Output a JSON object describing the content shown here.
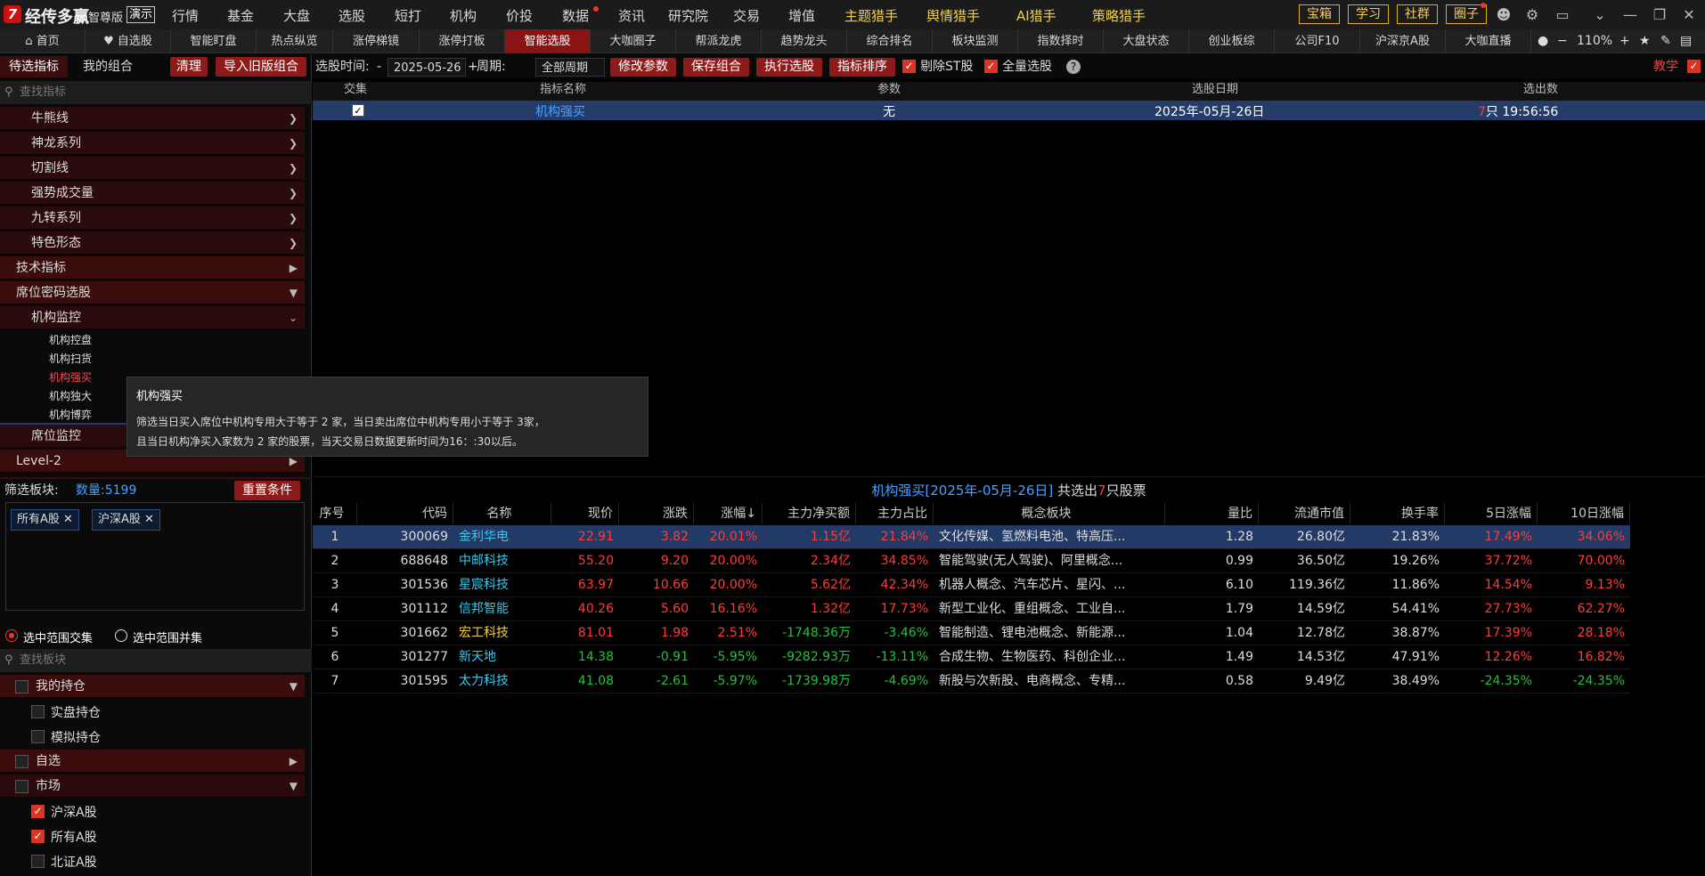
{
  "app": {
    "name": "经传多赢",
    "edition": "智尊版",
    "demo": "演示"
  },
  "top_nav": [
    "行情",
    "基金",
    "大盘",
    "选股",
    "短打",
    "机构",
    "价投",
    "数据",
    "资讯",
    "研究院",
    "交易",
    "增值"
  ],
  "top_nav_special": [
    "主题猎手",
    "舆情猎手",
    "AI猎手",
    "策略猎手"
  ],
  "top_right": [
    "宝箱",
    "学习",
    "社群",
    "圈子"
  ],
  "tabs": [
    "首页",
    "自选股",
    "智能盯盘",
    "热点纵览",
    "涨停梯镜",
    "涨停打板",
    "智能选股",
    "大咖圈子",
    "帮派龙虎",
    "趋势龙头",
    "综合排名",
    "板块监测",
    "指数择时",
    "大盘状态",
    "创业板综",
    "公司F10",
    "沪深京A股",
    "大咖直播"
  ],
  "zoom": "110%",
  "left": {
    "tab1": "待选指标",
    "tab2": "我的组合",
    "clear": "清理",
    "import": "导入旧版组合",
    "search_placeholder": "查找指标",
    "tree": [
      "牛熊线",
      "神龙系列",
      "切割线",
      "强势成交量",
      "九转系列",
      "特色形态",
      "技术指标",
      "席位密码选股",
      "机构监控"
    ],
    "leaves": [
      "机构控盘",
      "机构扫货",
      "机构强买",
      "机构独大",
      "机构博弈"
    ],
    "tree2": [
      "席位监控",
      "Level-2"
    ],
    "filter_label": "筛选板块:",
    "count": "数量:5199",
    "reset": "重置条件",
    "chips": [
      "所有A股",
      "沪深A股"
    ],
    "radio1": "选中范围交集",
    "radio2": "选中范围并集",
    "search2_placeholder": "查找板块",
    "groups": [
      "我的持仓",
      "实盘持仓",
      "模拟持仓",
      "自选",
      "市场",
      "沪深A股",
      "所有A股",
      "北证A股"
    ]
  },
  "filter": {
    "time_label": "选股时间:",
    "date": "2025-05-26",
    "period_label": "周期:",
    "period": "全部周期",
    "btn_modify": "修改参数",
    "btn_save": "保存组合",
    "btn_exec": "执行选股",
    "btn_sort": "指标排序",
    "exclude_st": "剔除ST股",
    "all_select": "全量选股",
    "teach": "教学"
  },
  "cond_table": {
    "headers": [
      "交集",
      "指标名称",
      "参数",
      "选股日期",
      "选出数"
    ],
    "row": {
      "name": "机构强买",
      "param": "无",
      "date": "2025年-05月-26日",
      "count": "7",
      "count_unit": "只",
      "time": "19:56:56"
    }
  },
  "tooltip": {
    "title": "机构强买",
    "line1": "筛选当日买入席位中机构专用大于等于 2 家，当日卖出席位中机构专用小于等于 3家，",
    "line2": "且当日机构净买入家数为 2 家的股票，当天交易日数据更新时间为16：:30以后。"
  },
  "result": {
    "title_pre": "机构强买[2025年-05月-26日]",
    "title_mid": " 共选出",
    "count": "7",
    "title_post": "只股票",
    "headers": [
      "序号",
      "代码",
      "名称",
      "现价",
      "涨跌",
      "涨幅↓",
      "主力净买额",
      "主力占比",
      "概念板块",
      "量比",
      "流通市值",
      "换手率",
      "5日涨幅",
      "10日涨幅"
    ],
    "rows": [
      [
        "1",
        "300069",
        "金利华电",
        "22.91",
        "3.82",
        "20.01%",
        "1.15亿",
        "21.84%",
        "文化传媒、氢燃料电池、特高压...",
        "1.28",
        "26.80亿",
        "21.83%",
        "17.49%",
        "34.06%"
      ],
      [
        "2",
        "688648",
        "中邮科技",
        "55.20",
        "9.20",
        "20.00%",
        "2.34亿",
        "34.85%",
        "智能驾驶(无人驾驶)、阿里概念...",
        "0.99",
        "36.50亿",
        "19.26%",
        "37.72%",
        "70.00%"
      ],
      [
        "3",
        "301536",
        "星宸科技",
        "63.97",
        "10.66",
        "20.00%",
        "5.62亿",
        "42.34%",
        "机器人概念、汽车芯片、星闪、...",
        "6.10",
        "119.36亿",
        "11.86%",
        "14.54%",
        "9.13%"
      ],
      [
        "4",
        "301112",
        "信邦智能",
        "40.26",
        "5.60",
        "16.16%",
        "1.32亿",
        "17.73%",
        "新型工业化、重组概念、工业自...",
        "1.79",
        "14.59亿",
        "54.41%",
        "27.73%",
        "62.27%"
      ],
      [
        "5",
        "301662",
        "宏工科技",
        "81.01",
        "1.98",
        "2.51%",
        "-1748.36万",
        "-3.46%",
        "智能制造、锂电池概念、新能源...",
        "1.04",
        "12.78亿",
        "38.87%",
        "17.39%",
        "28.18%"
      ],
      [
        "6",
        "301277",
        "新天地",
        "14.38",
        "-0.91",
        "-5.95%",
        "-9282.93万",
        "-13.11%",
        "合成生物、生物医药、科创企业...",
        "1.49",
        "14.53亿",
        "47.91%",
        "12.26%",
        "16.82%"
      ],
      [
        "7",
        "301595",
        "太力科技",
        "41.08",
        "-2.61",
        "-5.97%",
        "-1739.98万",
        "-4.69%",
        "新股与次新股、电商概念、专精...",
        "0.58",
        "9.49亿",
        "38.49%",
        "-24.35%",
        "-24.35%"
      ]
    ]
  },
  "colors": {
    "accent": "#8e1a1a",
    "up": "#ff3b3b",
    "down": "#23c23c",
    "selected": "#233a66"
  }
}
